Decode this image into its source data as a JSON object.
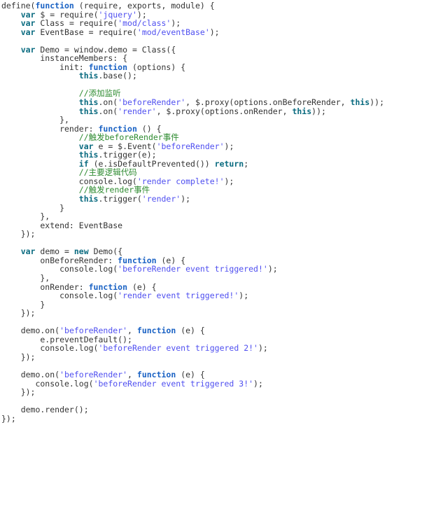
{
  "editor": {
    "language": "javascript",
    "background": "#ffffff",
    "colors": {
      "default_text": "#333333",
      "keyword_teal": "#0a6b80",
      "keyword_blue": "#1a62c4",
      "string": "#4f4ff0",
      "comment": "#2e8b30"
    }
  },
  "code_lines": [
    [
      {
        "t": "plain",
        "v": "define("
      },
      {
        "t": "kw2",
        "v": "function"
      },
      {
        "t": "plain",
        "v": " (require, exports, module) {"
      }
    ],
    [
      {
        "t": "plain",
        "v": "    "
      },
      {
        "t": "kw",
        "v": "var"
      },
      {
        "t": "plain",
        "v": " $ = require("
      },
      {
        "t": "str",
        "v": "'jquery'"
      },
      {
        "t": "plain",
        "v": ");"
      }
    ],
    [
      {
        "t": "plain",
        "v": "    "
      },
      {
        "t": "kw",
        "v": "var"
      },
      {
        "t": "plain",
        "v": " Class = require("
      },
      {
        "t": "str",
        "v": "'mod/class'"
      },
      {
        "t": "plain",
        "v": ");"
      }
    ],
    [
      {
        "t": "plain",
        "v": "    "
      },
      {
        "t": "kw",
        "v": "var"
      },
      {
        "t": "plain",
        "v": " EventBase = require("
      },
      {
        "t": "str",
        "v": "'mod/eventBase'"
      },
      {
        "t": "plain",
        "v": ");"
      }
    ],
    [
      {
        "t": "plain",
        "v": ""
      }
    ],
    [
      {
        "t": "plain",
        "v": "    "
      },
      {
        "t": "kw",
        "v": "var"
      },
      {
        "t": "plain",
        "v": " Demo = window.demo = Class({"
      }
    ],
    [
      {
        "t": "plain",
        "v": "        instanceMembers: {"
      }
    ],
    [
      {
        "t": "plain",
        "v": "            init: "
      },
      {
        "t": "kw2",
        "v": "function"
      },
      {
        "t": "plain",
        "v": " (options) {"
      }
    ],
    [
      {
        "t": "plain",
        "v": "                "
      },
      {
        "t": "kw",
        "v": "this"
      },
      {
        "t": "plain",
        "v": ".base();"
      }
    ],
    [
      {
        "t": "plain",
        "v": ""
      }
    ],
    [
      {
        "t": "plain",
        "v": "                "
      },
      {
        "t": "com",
        "v": "//添加监听"
      }
    ],
    [
      {
        "t": "plain",
        "v": "                "
      },
      {
        "t": "kw",
        "v": "this"
      },
      {
        "t": "plain",
        "v": ".on("
      },
      {
        "t": "str",
        "v": "'beforeRender'"
      },
      {
        "t": "plain",
        "v": ", $.proxy(options.onBeforeRender, "
      },
      {
        "t": "kw",
        "v": "this"
      },
      {
        "t": "plain",
        "v": "));"
      }
    ],
    [
      {
        "t": "plain",
        "v": "                "
      },
      {
        "t": "kw",
        "v": "this"
      },
      {
        "t": "plain",
        "v": ".on("
      },
      {
        "t": "str",
        "v": "'render'"
      },
      {
        "t": "plain",
        "v": ", $.proxy(options.onRender, "
      },
      {
        "t": "kw",
        "v": "this"
      },
      {
        "t": "plain",
        "v": "));"
      }
    ],
    [
      {
        "t": "plain",
        "v": "            },"
      }
    ],
    [
      {
        "t": "plain",
        "v": "            render: "
      },
      {
        "t": "kw2",
        "v": "function"
      },
      {
        "t": "plain",
        "v": " () {"
      }
    ],
    [
      {
        "t": "plain",
        "v": "                "
      },
      {
        "t": "com",
        "v": "//触发beforeRender事件"
      }
    ],
    [
      {
        "t": "plain",
        "v": "                "
      },
      {
        "t": "kw",
        "v": "var"
      },
      {
        "t": "plain",
        "v": " e = $.Event("
      },
      {
        "t": "str",
        "v": "'beforeRender'"
      },
      {
        "t": "plain",
        "v": ");"
      }
    ],
    [
      {
        "t": "plain",
        "v": "                "
      },
      {
        "t": "kw",
        "v": "this"
      },
      {
        "t": "plain",
        "v": ".trigger(e);"
      }
    ],
    [
      {
        "t": "plain",
        "v": "                "
      },
      {
        "t": "kw",
        "v": "if"
      },
      {
        "t": "plain",
        "v": " (e.isDefaultPrevented()) "
      },
      {
        "t": "kw",
        "v": "return"
      },
      {
        "t": "plain",
        "v": ";"
      }
    ],
    [
      {
        "t": "plain",
        "v": "                "
      },
      {
        "t": "com",
        "v": "//主要逻辑代码"
      }
    ],
    [
      {
        "t": "plain",
        "v": "                console.log("
      },
      {
        "t": "str",
        "v": "'render complete!'"
      },
      {
        "t": "plain",
        "v": ");"
      }
    ],
    [
      {
        "t": "plain",
        "v": "                "
      },
      {
        "t": "com",
        "v": "//触发render事件"
      }
    ],
    [
      {
        "t": "plain",
        "v": "                "
      },
      {
        "t": "kw",
        "v": "this"
      },
      {
        "t": "plain",
        "v": ".trigger("
      },
      {
        "t": "str",
        "v": "'render'"
      },
      {
        "t": "plain",
        "v": ");"
      }
    ],
    [
      {
        "t": "plain",
        "v": "            }"
      }
    ],
    [
      {
        "t": "plain",
        "v": "        },"
      }
    ],
    [
      {
        "t": "plain",
        "v": "        extend: EventBase"
      }
    ],
    [
      {
        "t": "plain",
        "v": "    });"
      }
    ],
    [
      {
        "t": "plain",
        "v": ""
      }
    ],
    [
      {
        "t": "plain",
        "v": "    "
      },
      {
        "t": "kw",
        "v": "var"
      },
      {
        "t": "plain",
        "v": " demo = "
      },
      {
        "t": "kw",
        "v": "new"
      },
      {
        "t": "plain",
        "v": " Demo({"
      }
    ],
    [
      {
        "t": "plain",
        "v": "        onBeforeRender: "
      },
      {
        "t": "kw2",
        "v": "function"
      },
      {
        "t": "plain",
        "v": " (e) {"
      }
    ],
    [
      {
        "t": "plain",
        "v": "            console.log("
      },
      {
        "t": "str",
        "v": "'beforeRender event triggered!'"
      },
      {
        "t": "plain",
        "v": ");"
      }
    ],
    [
      {
        "t": "plain",
        "v": "        },"
      }
    ],
    [
      {
        "t": "plain",
        "v": "        onRender: "
      },
      {
        "t": "kw2",
        "v": "function"
      },
      {
        "t": "plain",
        "v": " (e) {"
      }
    ],
    [
      {
        "t": "plain",
        "v": "            console.log("
      },
      {
        "t": "str",
        "v": "'render event triggered!'"
      },
      {
        "t": "plain",
        "v": ");"
      }
    ],
    [
      {
        "t": "plain",
        "v": "        }"
      }
    ],
    [
      {
        "t": "plain",
        "v": "    });"
      }
    ],
    [
      {
        "t": "plain",
        "v": ""
      }
    ],
    [
      {
        "t": "plain",
        "v": "    demo.on("
      },
      {
        "t": "str",
        "v": "'beforeRender'"
      },
      {
        "t": "plain",
        "v": ", "
      },
      {
        "t": "kw2",
        "v": "function"
      },
      {
        "t": "plain",
        "v": " (e) {"
      }
    ],
    [
      {
        "t": "plain",
        "v": "        e.preventDefault();"
      }
    ],
    [
      {
        "t": "plain",
        "v": "        console.log("
      },
      {
        "t": "str",
        "v": "'beforeRender event triggered 2!'"
      },
      {
        "t": "plain",
        "v": ");"
      }
    ],
    [
      {
        "t": "plain",
        "v": "    });"
      }
    ],
    [
      {
        "t": "plain",
        "v": ""
      }
    ],
    [
      {
        "t": "plain",
        "v": "    demo.on("
      },
      {
        "t": "str",
        "v": "'beforeRender'"
      },
      {
        "t": "plain",
        "v": ", "
      },
      {
        "t": "kw2",
        "v": "function"
      },
      {
        "t": "plain",
        "v": " (e) {"
      }
    ],
    [
      {
        "t": "plain",
        "v": "       console.log("
      },
      {
        "t": "str",
        "v": "'beforeRender event triggered 3!'"
      },
      {
        "t": "plain",
        "v": ");"
      }
    ],
    [
      {
        "t": "plain",
        "v": "    });"
      }
    ],
    [
      {
        "t": "plain",
        "v": ""
      }
    ],
    [
      {
        "t": "plain",
        "v": "    demo.render();"
      }
    ],
    [
      {
        "t": "plain",
        "v": "});"
      }
    ]
  ]
}
